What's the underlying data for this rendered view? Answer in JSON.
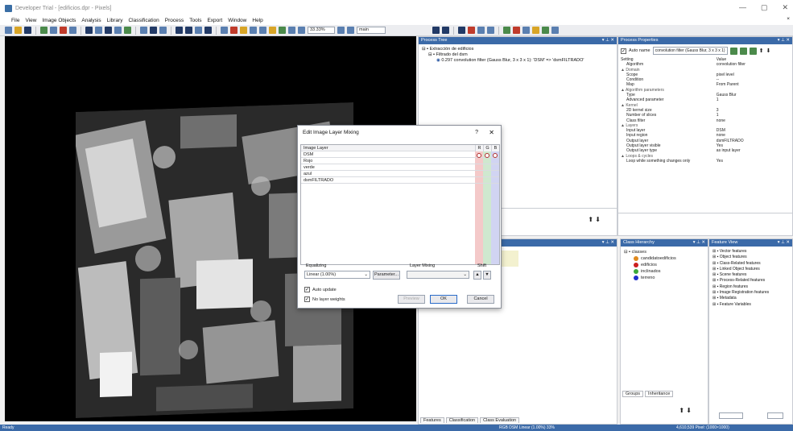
{
  "window": {
    "title": "Developer Trial - [edificios.dpr - Pixels]"
  },
  "menu": [
    "File",
    "View",
    "Image Objects",
    "Analysis",
    "Library",
    "Classification",
    "Process",
    "Tools",
    "Export",
    "Window",
    "Help"
  ],
  "toolbar": {
    "zoom": "33.33%",
    "map": "main"
  },
  "process_tree": {
    "title": "Process Tree",
    "items": [
      "Extracción de edificios",
      "Filtrado del dsm",
      "0.297   convolution filter (Gauss Blur, 3 x 3 x 1): 'DSM' => 'dsmFILTRADO'"
    ]
  },
  "process_properties": {
    "title": "Process Properties",
    "auto_name_label": "Auto name",
    "auto_name_value": "convolution filter (Gauss Blur, 3 x 3 x 1)",
    "col_setting": "Setting",
    "col_value": "Value",
    "rows": [
      {
        "k": "Algorithm",
        "v": "convolution filter",
        "sec": false
      },
      {
        "k": "▲ Domain",
        "v": "",
        "sec": true
      },
      {
        "k": "Scope",
        "v": "pixel level",
        "sec": false
      },
      {
        "k": "Condition",
        "v": "--",
        "sec": false
      },
      {
        "k": "Map",
        "v": "From Parent",
        "sec": false
      },
      {
        "k": "▲ Algorithm parameters",
        "v": "",
        "sec": true
      },
      {
        "k": "Type",
        "v": "Gauss Blur",
        "sec": false
      },
      {
        "k": "Advanced parameter",
        "v": "1",
        "sec": false
      },
      {
        "k": "▲ Kernel",
        "v": "",
        "sec": true
      },
      {
        "k": "2D kernel size",
        "v": "3",
        "sec": false
      },
      {
        "k": "Number of slices",
        "v": "1",
        "sec": false
      },
      {
        "k": "Class filter",
        "v": "none",
        "sec": false
      },
      {
        "k": "▲ Layers",
        "v": "",
        "sec": true
      },
      {
        "k": "Input layer",
        "v": "DSM",
        "sec": false
      },
      {
        "k": "Input region",
        "v": "none",
        "sec": false
      },
      {
        "k": "Output layer",
        "v": "dsmFILTRADO",
        "sec": false
      },
      {
        "k": "Output layer visible",
        "v": "Yes",
        "sec": false
      },
      {
        "k": "Output layer type",
        "v": "as input layer",
        "sec": false
      },
      {
        "k": "▲ Loops & cycles",
        "v": "",
        "sec": true
      },
      {
        "k": "Loop while something changes only",
        "v": "Yes",
        "sec": false
      }
    ]
  },
  "features_tabs": [
    "Features",
    "Classification",
    "Class Evaluation"
  ],
  "class_hierarchy": {
    "title": "Class Hierarchy",
    "root": "classes",
    "classes": [
      {
        "name": "candidatoedificios",
        "color": "#e08a1e"
      },
      {
        "name": "edificios",
        "color": "#cc1f1f"
      },
      {
        "name": "inclinados",
        "color": "#3aa83a"
      },
      {
        "name": "terreno",
        "color": "#1f2fcc"
      }
    ],
    "tabs": [
      "Groups",
      "Inheritance"
    ]
  },
  "feature_view": {
    "title": "Feature View",
    "items": [
      "Vector features",
      "Object features",
      "Class-Related features",
      "Linked Object features",
      "Scene features",
      "Process-Related features",
      "Region features",
      "Image Registration features",
      "Metadata",
      "Feature Variables"
    ]
  },
  "dialog": {
    "title": "Edit Image Layer Mixing",
    "help": "?",
    "close": "✕",
    "col_layer": "Image Layer",
    "col_r": "R",
    "col_g": "G",
    "col_b": "B",
    "layers": [
      "DSM",
      "Rojo",
      "verde",
      "azul",
      "dsmFILTRADO"
    ],
    "equalizing_label": "Equalizing",
    "equalizing_value": "Linear (1.00%)",
    "parameter_button": "Parameter...",
    "layer_mixing_label": "Layer Mixing",
    "shift_label": "Shift",
    "auto_update": "Auto update",
    "no_layer_weights": "No layer weights",
    "preview_button": "Preview",
    "ok_button": "OK",
    "cancel_button": "Cancel"
  },
  "status": {
    "left": "Ready",
    "info": "RGB  DSM  Linear (1.00%)  33%",
    "info2": "4,610,539 Pixel: (1000×1000)"
  }
}
